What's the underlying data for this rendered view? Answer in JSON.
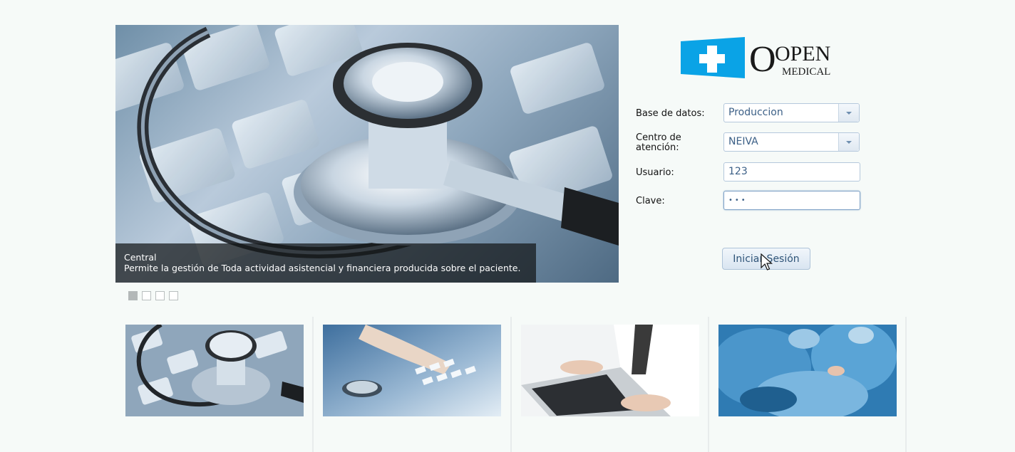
{
  "logo": {
    "brand_top": "OPEN",
    "brand_bottom": "MEDICAL"
  },
  "slider": {
    "caption_title": "Central",
    "caption_text": "Permite la gestión de Toda actividad asistencial y financiera producida sobre el paciente.",
    "pager_count": 4,
    "active_index": 0
  },
  "form": {
    "database_label": "Base de datos:",
    "database_value": "Produccion",
    "center_label": "Centro de atención:",
    "center_value": "NEIVA",
    "user_label": "Usuario:",
    "user_value": "123",
    "password_label": "Clave:",
    "password_value": "•••",
    "login_button": "Iniciar Sesión"
  },
  "icons": {
    "dropdown": "chevron-down-icon",
    "cursor": "mouse-pointer-icon"
  },
  "colors": {
    "logo_blue": "#0aa3e6",
    "field_text": "#3b5f86",
    "caption_bg": "#141618"
  }
}
